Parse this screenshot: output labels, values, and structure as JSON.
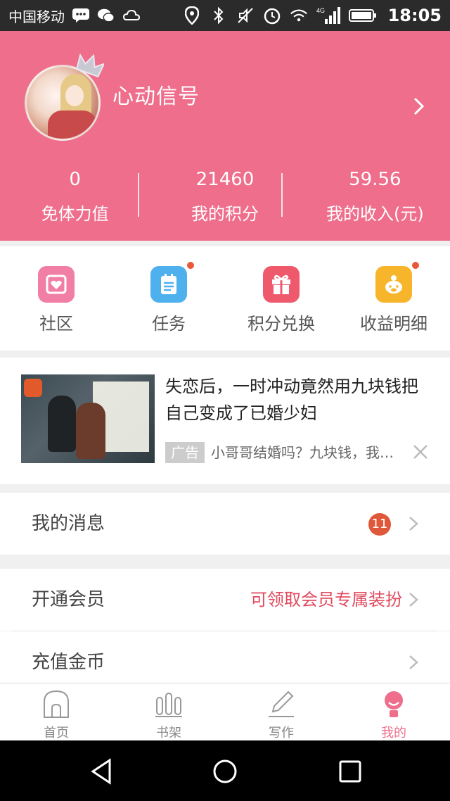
{
  "status_bar": {
    "carrier": "中国移动",
    "network": "4G",
    "time": "18:05"
  },
  "profile": {
    "nickname": "心动信号",
    "stats": [
      {
        "value": "0",
        "label": "免体力值"
      },
      {
        "value": "21460",
        "label": "我的积分"
      },
      {
        "value": "59.56",
        "label": "我的收入(元)"
      }
    ]
  },
  "actions": [
    {
      "label": "社区",
      "icon": "community-icon",
      "color": "#f17fa5"
    },
    {
      "label": "任务",
      "icon": "task-icon",
      "color": "#4fb0ee"
    },
    {
      "label": "积分兑换",
      "icon": "gift-icon",
      "color": "#ee5a6c"
    },
    {
      "label": "收益明细",
      "icon": "piggy-icon",
      "color": "#f7b52c"
    }
  ],
  "ad": {
    "title": "失恋后，一时冲动竟然用九块钱把自己变成了已婚少妇",
    "tag": "广告",
    "subtitle": "小哥哥结婚吗？九块钱，我…"
  },
  "rows": {
    "messages": {
      "label": "我的消息",
      "badge": "11"
    },
    "vip": {
      "label": "开通会员",
      "promo": "可领取会员专属装扮"
    },
    "recharge": {
      "label": "充值金币"
    }
  },
  "tabs": [
    {
      "label": "首页",
      "icon": "home-icon"
    },
    {
      "label": "书架",
      "icon": "bookshelf-icon"
    },
    {
      "label": "写作",
      "icon": "pen-icon"
    },
    {
      "label": "我的",
      "icon": "profile-icon"
    }
  ],
  "colors": {
    "brand": "#ee6e8c",
    "badge": "#e0583a",
    "promo": "#e04a5e"
  }
}
